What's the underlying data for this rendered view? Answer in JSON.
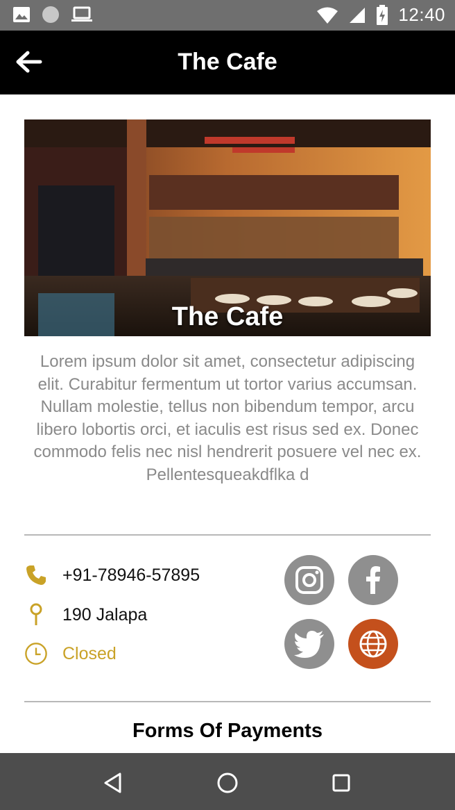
{
  "status_bar": {
    "time": "12:40"
  },
  "app_bar": {
    "title": "The Cafe"
  },
  "hero": {
    "title": "The Cafe"
  },
  "description": "Lorem ipsum dolor sit amet, consectetur adipiscing elit. Curabitur fermentum ut tortor varius accumsan. Nullam molestie, tellus non bibendum tempor, arcu libero lobortis orci, et iaculis est risus sed ex. Donec commodo felis nec nisl hendrerit posuere vel nec ex. Pellentesqueakdflka d",
  "contact": {
    "phone": "+91-78946-57895",
    "address": "190 Jalapa",
    "hours_status": "Closed"
  },
  "social": [
    "instagram-icon",
    "facebook-icon",
    "twitter-icon",
    "website-globe-icon"
  ],
  "sections": {
    "payments_title": "Forms Of Payments"
  },
  "colors": {
    "accent_gold": "#c9a227",
    "social_gray": "#8f8f8f",
    "web_orange": "#c4501c",
    "status_bar": "#6f6f6f",
    "app_bar": "#000000",
    "nav_bar": "#4d4d4d"
  }
}
